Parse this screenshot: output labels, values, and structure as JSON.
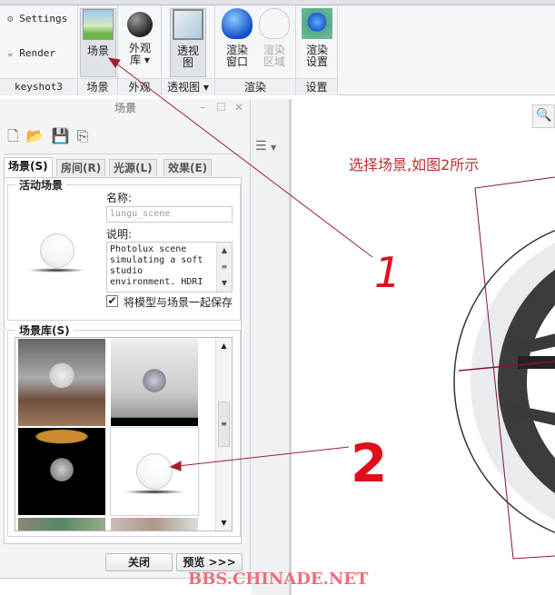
{
  "ribbon": {
    "settings_label": "Settings",
    "render_label": "Render",
    "scene_btn": "场景",
    "appearance_btn_line1": "外观",
    "appearance_btn_line2": "库 ▾",
    "perspective_btn_line1": "透视",
    "perspective_btn_line2": "图",
    "render_window_line1": "渲染",
    "render_window_line2": "窗口",
    "render_region_line1": "渲染",
    "render_region_line2": "区域",
    "render_settings_line1": "渲染",
    "render_settings_line2": "设置",
    "groups": [
      "keyshot3",
      "场景",
      "外观",
      "透视图 ▾",
      "渲染",
      "设置"
    ]
  },
  "panel": {
    "title": "场景",
    "tabs": [
      "场景(S)",
      "房间(R)",
      "光源(L)",
      "效果(E)"
    ],
    "active_scene_legend": "活动场景",
    "name_label": "名称:",
    "name_value": "lungu_scene",
    "desc_label": "说明:",
    "desc_value": "Photolux scene simulating a soft studio environment. HDRI",
    "save_checkbox_label": "将模型与场景一起保存",
    "save_checked": true,
    "library_legend": "场景库(S)",
    "close_btn": "关闭",
    "preview_btn": "预览 >>>"
  },
  "annotations": {
    "instruction": "选择场景,如图2所示",
    "mark1": "1",
    "mark2": "2",
    "watermark": "BBS.CHINADE.NET"
  },
  "colors": {
    "annotation": "#e0101a",
    "arrow": "#a0202a"
  }
}
